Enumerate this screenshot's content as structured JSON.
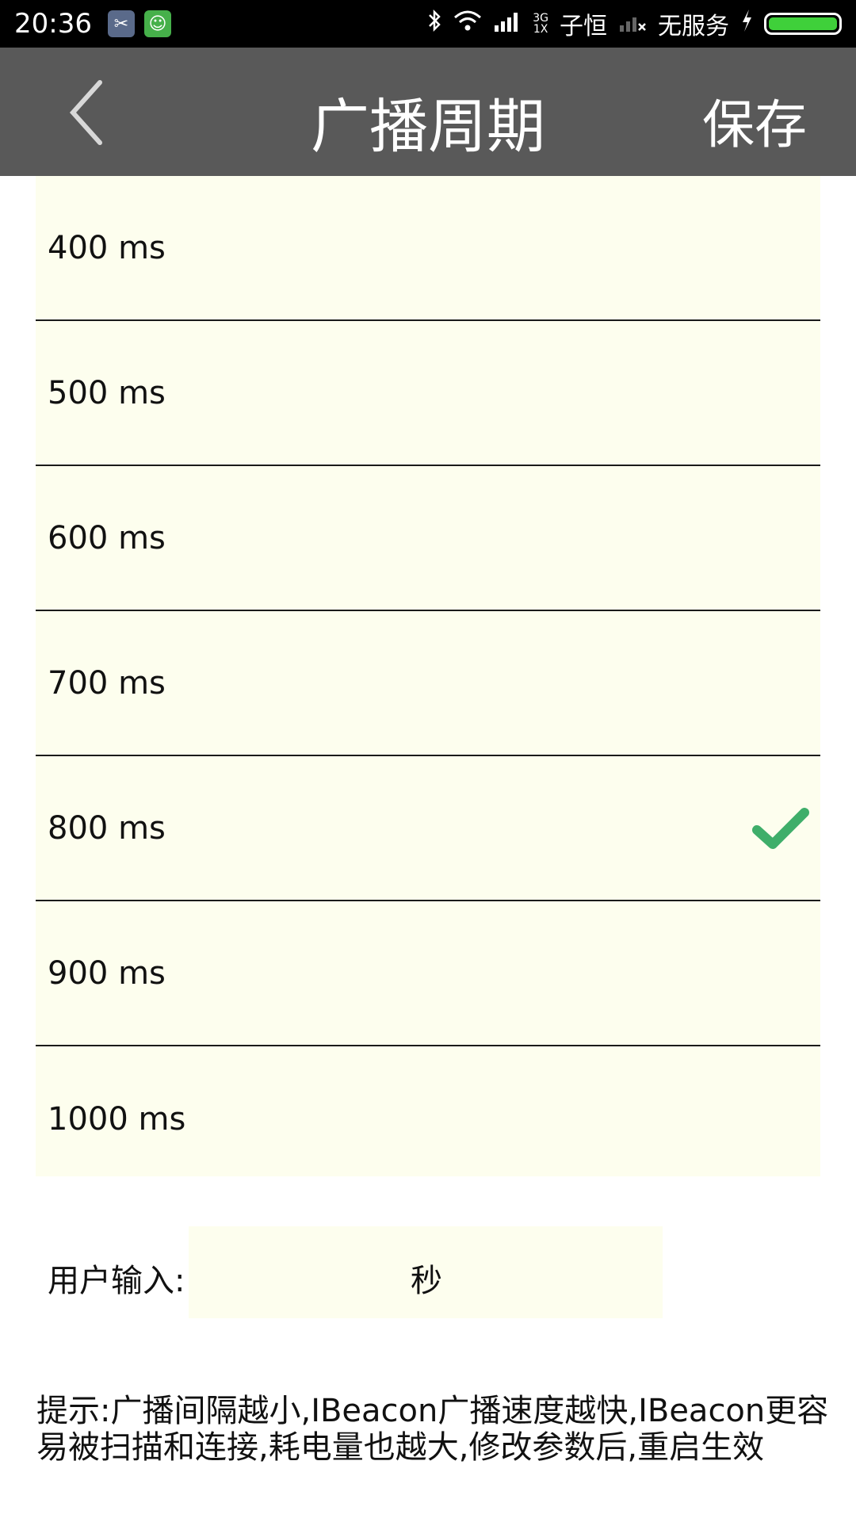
{
  "status_bar": {
    "time": "20:36",
    "net_3g": "3G",
    "net_1x": "1X",
    "carrier": "子恒",
    "no_service": "无服务",
    "battery_level": 1.0,
    "icons": [
      "app-icon",
      "app-icon",
      "bluetooth-icon",
      "wifi-icon",
      "signal-icon",
      "signal-icon",
      "charging-icon",
      "battery-icon"
    ]
  },
  "header": {
    "title": "广播周期",
    "save_label": "保存",
    "back_icon": "chevron-left-icon"
  },
  "options": [
    {
      "label": "400 ms",
      "selected": false
    },
    {
      "label": "500 ms",
      "selected": false
    },
    {
      "label": "600 ms",
      "selected": false
    },
    {
      "label": "700 ms",
      "selected": false
    },
    {
      "label": "800 ms",
      "selected": true
    },
    {
      "label": "900 ms",
      "selected": false
    },
    {
      "label": "1000 ms",
      "selected": false
    }
  ],
  "user_input": {
    "label": "用户输入:",
    "value": "",
    "unit": "秒"
  },
  "hint": "提示:广播间隔越小,IBeacon广播速度越快,IBeacon更容易被扫描和连接,耗电量也越大,修改参数后,重启生效",
  "colors": {
    "header_bg": "#595959",
    "list_bg": "#fdfeee",
    "check": "#3fae6a"
  }
}
